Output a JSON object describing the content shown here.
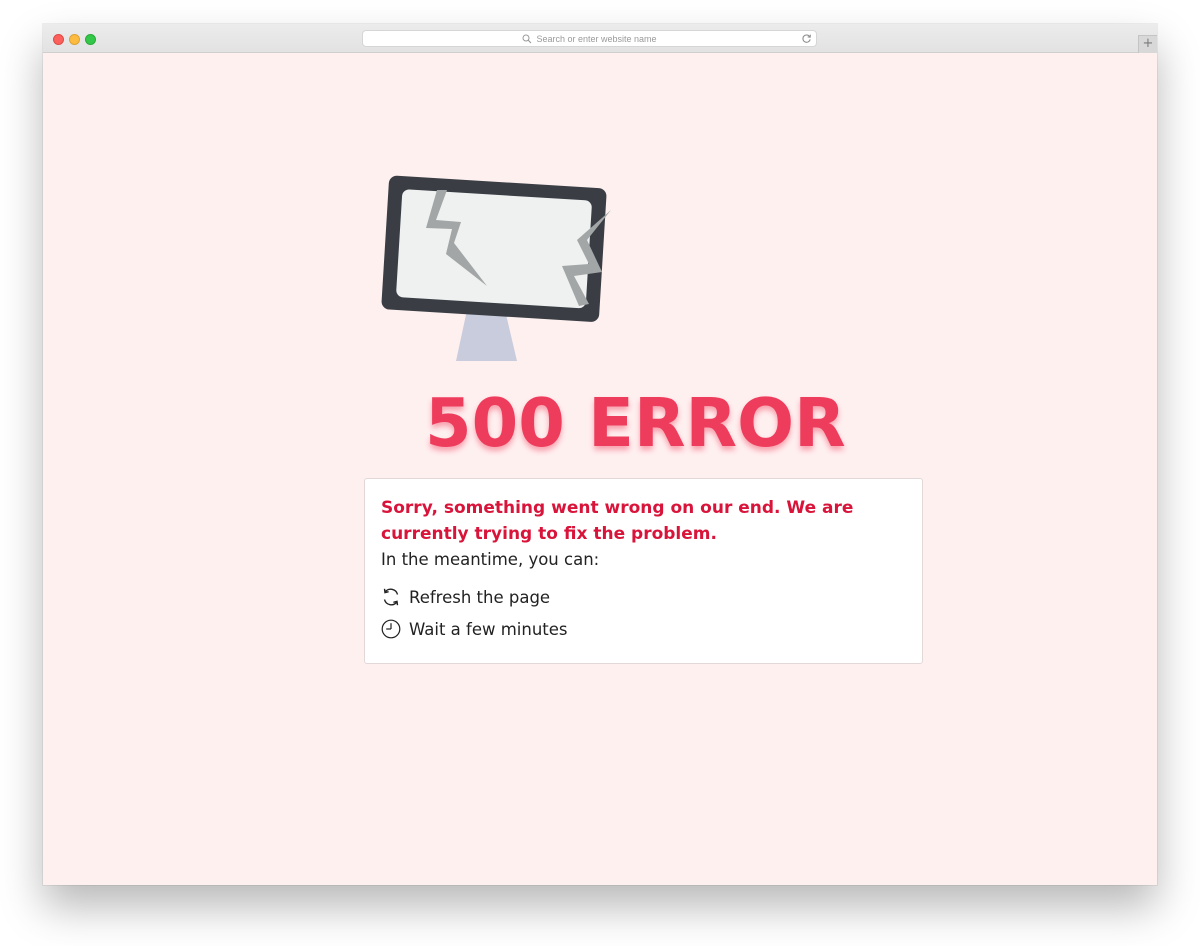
{
  "browser": {
    "address_placeholder": "Search or enter website name",
    "new_tab_symbol": "+"
  },
  "error": {
    "heading": "500 ERROR",
    "apology": "Sorry, something went wrong on our end. We are currently trying to fix the problem.",
    "intro": "In the meantime, you can:",
    "actions": [
      {
        "label": "Refresh the page",
        "icon": "refresh-icon"
      },
      {
        "label": "Wait a few minutes",
        "icon": "clock-icon"
      }
    ]
  },
  "colors": {
    "page_background": "#fff0f0",
    "heading": "#ee3d5c",
    "apology_text": "#d9143a",
    "monitor_frame": "#3a3e44",
    "monitor_screen": "#eef1f0",
    "monitor_stand": "#c9ccdc",
    "crack": "#a3a6a6"
  }
}
